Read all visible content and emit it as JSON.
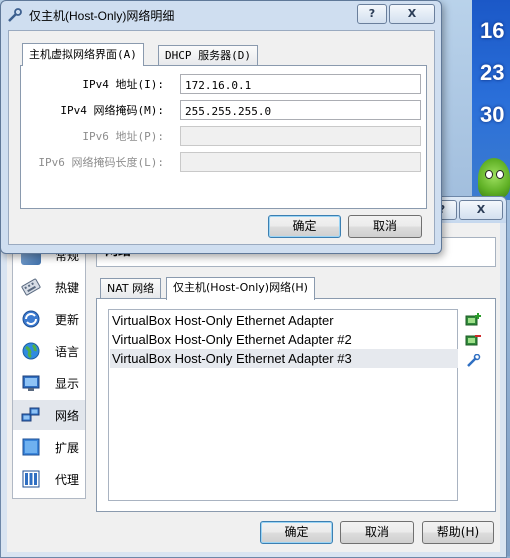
{
  "desktop": {
    "widget_numbers": [
      "16",
      "23",
      "30"
    ]
  },
  "preferences": {
    "titlebar_buttons": {
      "help": "?",
      "close": "X"
    },
    "section_title": "网络",
    "sidebar": [
      {
        "label": "常规",
        "icon": "general-icon"
      },
      {
        "label": "热键",
        "icon": "keyboard-icon"
      },
      {
        "label": "更新",
        "icon": "update-icon"
      },
      {
        "label": "语言",
        "icon": "globe-icon"
      },
      {
        "label": "显示",
        "icon": "display-icon"
      },
      {
        "label": "网络",
        "icon": "network-icon",
        "selected": true
      },
      {
        "label": "扩展",
        "icon": "extension-icon"
      },
      {
        "label": "代理",
        "icon": "proxy-icon"
      }
    ],
    "tabs": {
      "nat": "NAT 网络",
      "host_only": "仅主机(Host-Only)网络(H)"
    },
    "adapters": [
      "VirtualBox Host-Only Ethernet Adapter",
      "VirtualBox Host-Only Ethernet Adapter #2",
      "VirtualBox Host-Only Ethernet Adapter #3"
    ],
    "buttons": {
      "ok": "确定",
      "cancel": "取消",
      "help": "帮助(H)"
    }
  },
  "dialog": {
    "title": "仅主机(Host-Only)网络明细",
    "titlebar_buttons": {
      "help": "?",
      "close": "X"
    },
    "tabs": {
      "adapter": "主机虚拟网络界面(A)",
      "dhcp": "DHCP 服务器(D)"
    },
    "fields": {
      "ipv4_address": {
        "label": "IPv4 地址(I):",
        "value": "172.16.0.1"
      },
      "ipv4_mask": {
        "label": "IPv4 网络掩码(M):",
        "value": "255.255.255.0"
      },
      "ipv6_address": {
        "label": "IPv6 地址(P):",
        "value": ""
      },
      "ipv6_prefix": {
        "label": "IPv6 网络掩码长度(L):",
        "value": ""
      }
    },
    "buttons": {
      "ok": "确定",
      "cancel": "取消"
    }
  },
  "colors": {
    "accent": "#3c7fb1",
    "selection": "#e6e9ee",
    "desktop_widget": "#1b58c7"
  }
}
